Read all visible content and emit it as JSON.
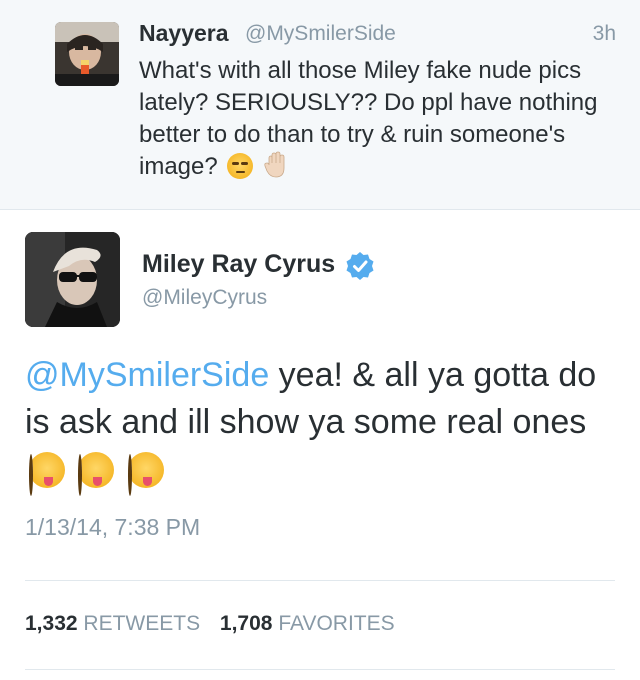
{
  "reply": {
    "name": "Nayyera",
    "handle": "@MySmilerSide",
    "time": "3h",
    "text": "What's with all those Miley fake nude pics lately? SERIOUSLY?? Do ppl have nothing better to do than to try & ruin someone's image?",
    "emojis": [
      "unamused-face-icon",
      "raised-hand-icon"
    ]
  },
  "tweet": {
    "name": "Miley Ray Cyrus",
    "handle": "@MileyCyrus",
    "verified": true,
    "mention": "@MySmilerSide",
    "text": " yea! & all ya gotta do is ask and ill show ya some real ones",
    "emojis": [
      "winking-tongue-face-icon",
      "winking-tongue-face-icon",
      "winking-tongue-face-icon"
    ],
    "date": "1/13/14, 7:38 PM"
  },
  "stats": {
    "retweets_count": "1,332",
    "retweets_label": "RETWEETS",
    "favorites_count": "1,708",
    "favorites_label": "FAVORITES"
  },
  "colors": {
    "link": "#55acee",
    "secondary_text": "#8899a6",
    "primary_text": "#292f33",
    "reply_background": "#f5f8fa"
  }
}
